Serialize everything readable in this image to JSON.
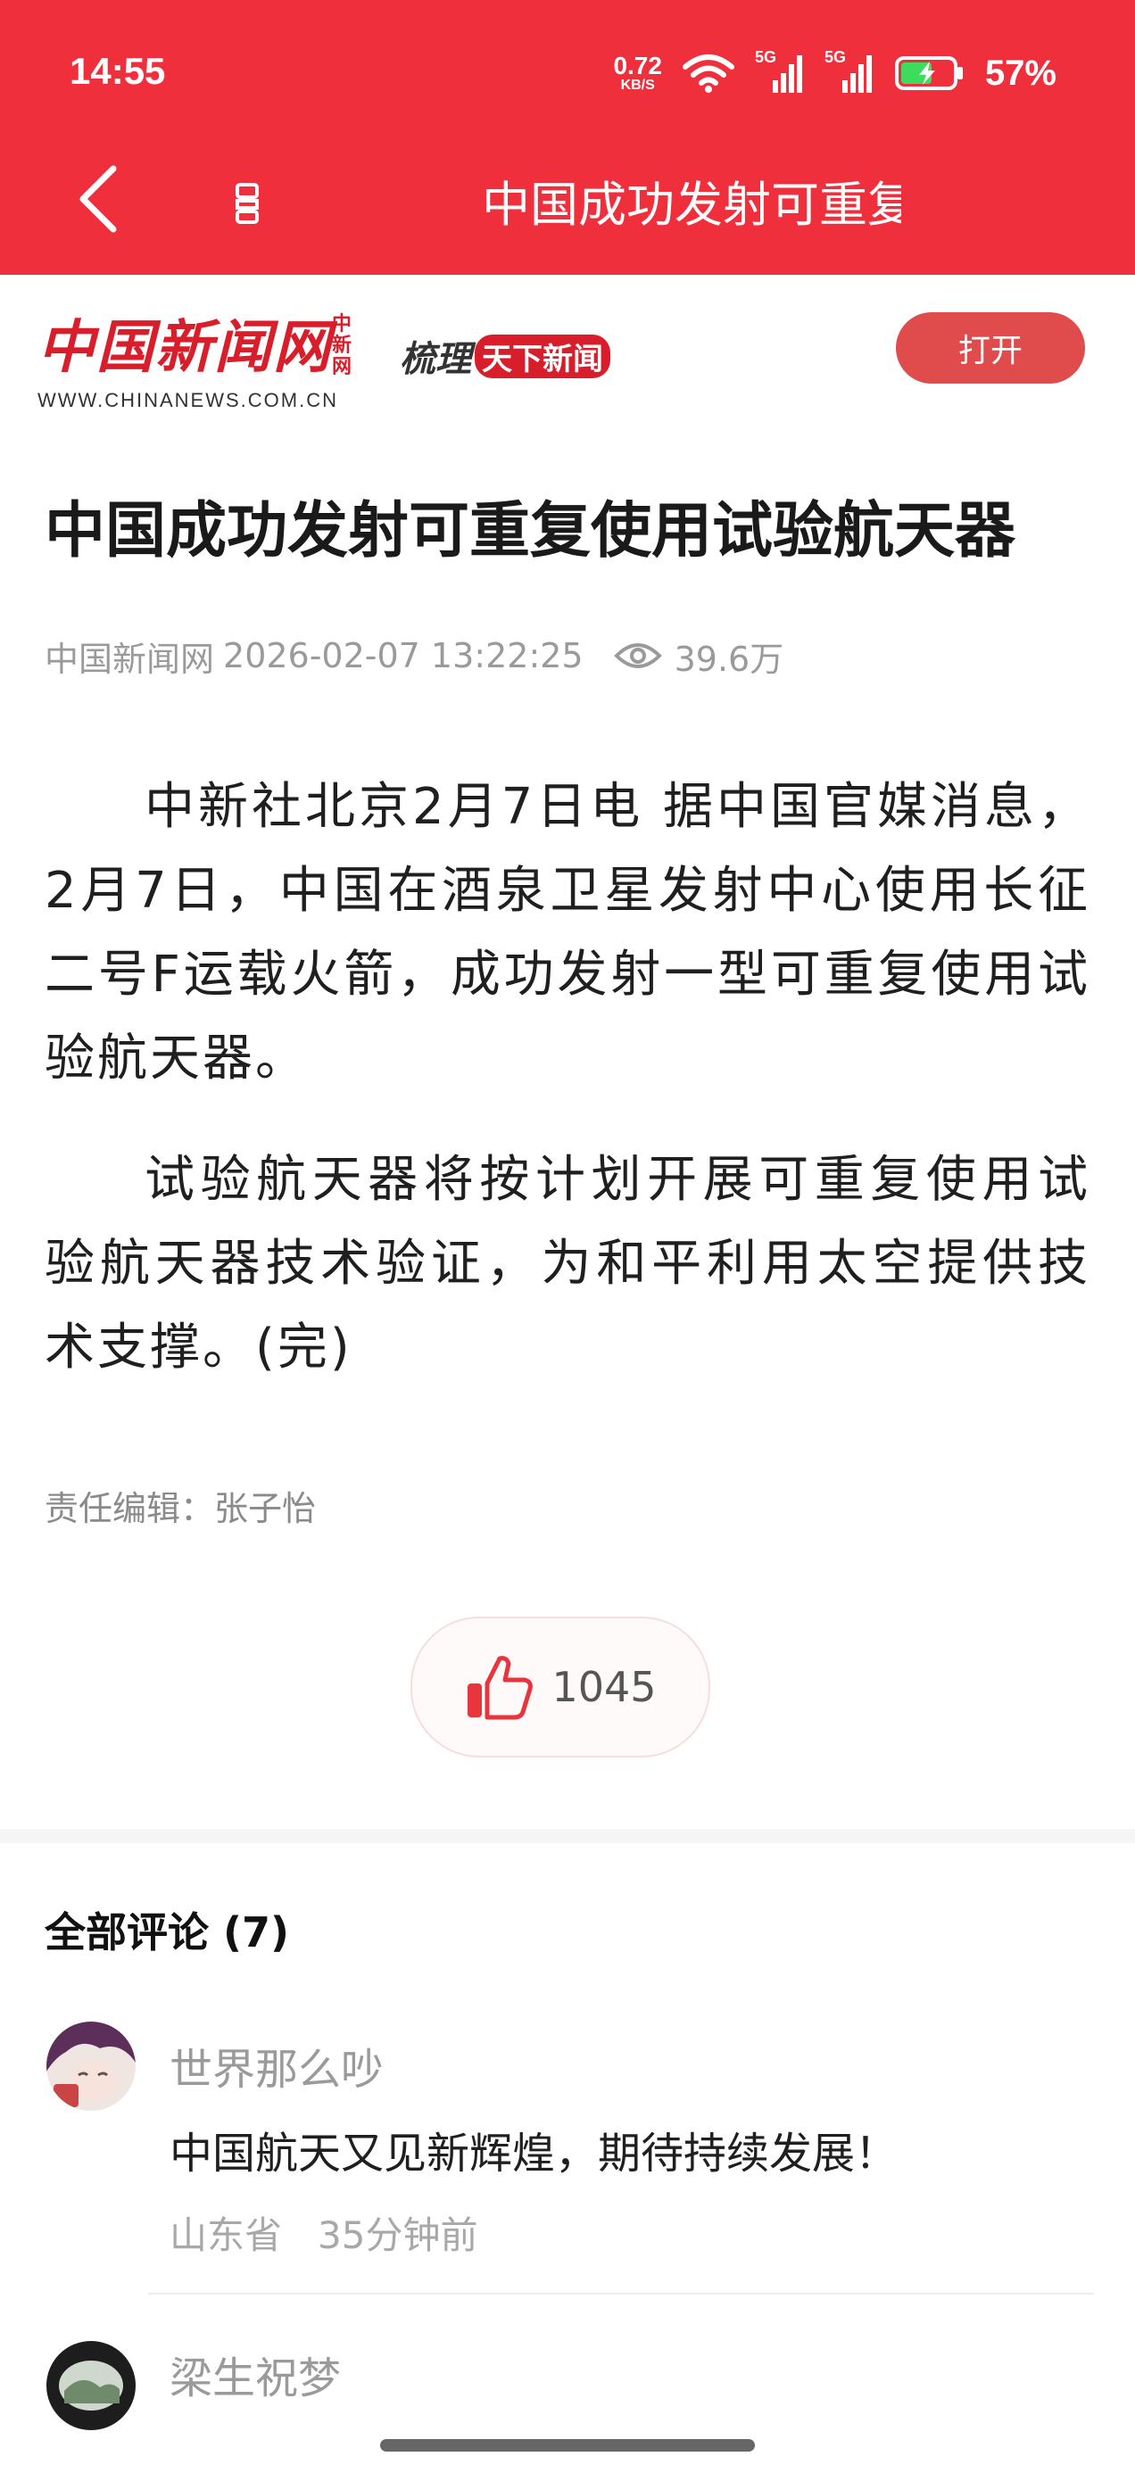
{
  "status_bar": {
    "time": "14:55",
    "net_speed_value": "0.72",
    "net_speed_unit": "KB/S",
    "signal1_label": "5G",
    "signal2_label": "5G",
    "battery_percent": "57%"
  },
  "nav": {
    "title": "中国成功发射可重复使用试验航天器",
    "back_icon": "chevron-left-icon",
    "audio_icon": "audio-icon"
  },
  "banner": {
    "logo_text": "中国新闻网",
    "logo_small": "中新网",
    "logo_url": "WWW.CHINANEWS.COM.CN",
    "slogan_prefix": "梳理",
    "slogan_highlight": "天下新闻",
    "open_label": "打开"
  },
  "article": {
    "headline": "中国成功发射可重复使用试验航天器",
    "source": "中国新闻网",
    "datetime": "2026-02-07 13:22:25",
    "views": "39.6万",
    "paragraphs": [
      "中新社北京2月7日电 据中国官媒消息，2月7日，中国在酒泉卫星发射中心使用长征二号F运载火箭，成功发射一型可重复使用试验航天器。",
      "试验航天器将按计划开展可重复使用试验航天器技术验证，为和平利用太空提供技术支撑。(完)"
    ],
    "editor": "责任编辑：张子怡",
    "likes": "1045"
  },
  "comments": {
    "title": "全部评论 (7)",
    "items": [
      {
        "user": "世界那么吵",
        "text": "中国航天又见新辉煌，期待持续发展！",
        "location": "山东省",
        "time": "35分钟前"
      },
      {
        "user": "梁生祝梦",
        "text": "",
        "location": "",
        "time": ""
      }
    ]
  },
  "colors": {
    "brand_red": "#ef2f3c",
    "button_red": "#e04b4b",
    "logo_red": "#d81e2a"
  }
}
